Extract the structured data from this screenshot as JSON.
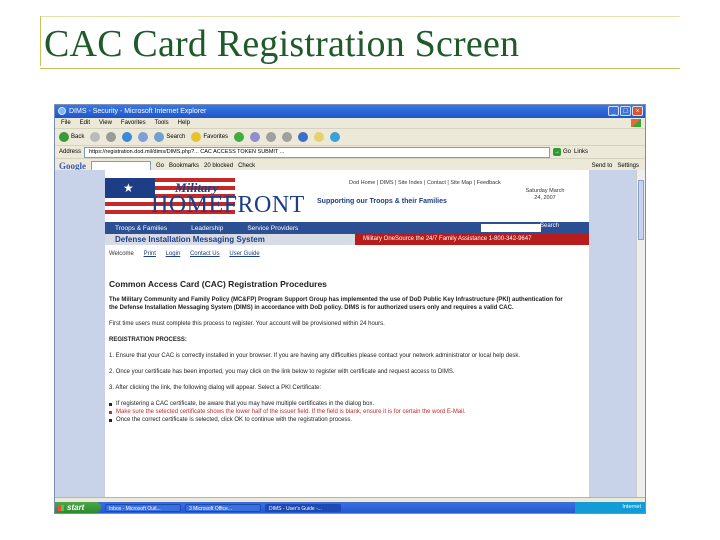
{
  "slide": {
    "title": "CAC Card Registration Screen"
  },
  "browser": {
    "window_title": "DIMS - Security - Microsoft Internet Explorer",
    "menu": [
      "File",
      "Edit",
      "View",
      "Favorites",
      "Tools",
      "Help"
    ],
    "toolbar": {
      "back": "Back",
      "search": "Search",
      "favorites": "Favorites"
    },
    "address_label": "Address",
    "address_value": "https://registration.dod.mil/dims/DIMS.php?... CAC ACCESS TOKEN SUBMIT ...",
    "go_label": "Go",
    "links_label": "Links",
    "google": {
      "logo": "Google",
      "go": "Go",
      "bookmarks": "Bookmarks",
      "blocked": "20 blocked",
      "check": "Check",
      "sendto": "Send to",
      "settings": "Settings"
    }
  },
  "site": {
    "military": "Military",
    "homefront": "HOMEFRONT",
    "tagline": "Supporting our Troops & their Families",
    "top_links": "Dod Home | DIMS | Site Index | Contact | Site Map | Feedback",
    "date": "Saturday March 24, 2007",
    "nav": [
      "Troops & Families",
      "Leadership",
      "Service Providers"
    ],
    "search_label": "Search",
    "subheader": "Defense Installation Messaging System",
    "hotline": "Military OneSource the 24/7 Family Assistance 1-800-342-9647",
    "breadcrumb": {
      "prefix": "Welcome",
      "links": [
        "Print",
        "Login",
        "Contact Us",
        "User Guide"
      ]
    }
  },
  "content": {
    "heading": "Common Access Card (CAC) Registration Procedures",
    "intro": "The Military Community and Family Policy (MC&FP) Program Support Group has implemented the use of DoD Public Key Infrastructure (PKI) authentication for the Defense Installation Messaging System (DIMS) in accordance with DoD policy. DIMS is for authorized users only and requires a valid CAC.",
    "note": "First time users must complete this process to register. Your account will be provisioned within 24 hours.",
    "process_heading": "REGISTRATION PROCESS:",
    "steps": [
      "1. Ensure that your CAC is correctly installed in your browser. If you are having any difficulties please contact your network administrator or local help desk.",
      "2. Once your certificate has been imported, you may click on the link below to register with certificate and request access to DIMS.",
      "3. After clicking the link, the following dialog will appear. Select a PKI Certificate:"
    ],
    "bullets": [
      "If registering a CAC certificate, be aware that you may have multiple certificates in the dialog box.",
      "Make sure the selected certificate shows the lower half of the issuer field. If the field is blank, ensure it is for certain the word E-Mail.",
      "Once the correct certificate is selected, click OK to continue with the registration process."
    ]
  },
  "taskbar": {
    "start": "start",
    "tasks": [
      "Inbox - Microsoft Outl...",
      "3 Microsoft Office...",
      "DIMS - User's Guide -..."
    ],
    "tray": "Internet"
  }
}
